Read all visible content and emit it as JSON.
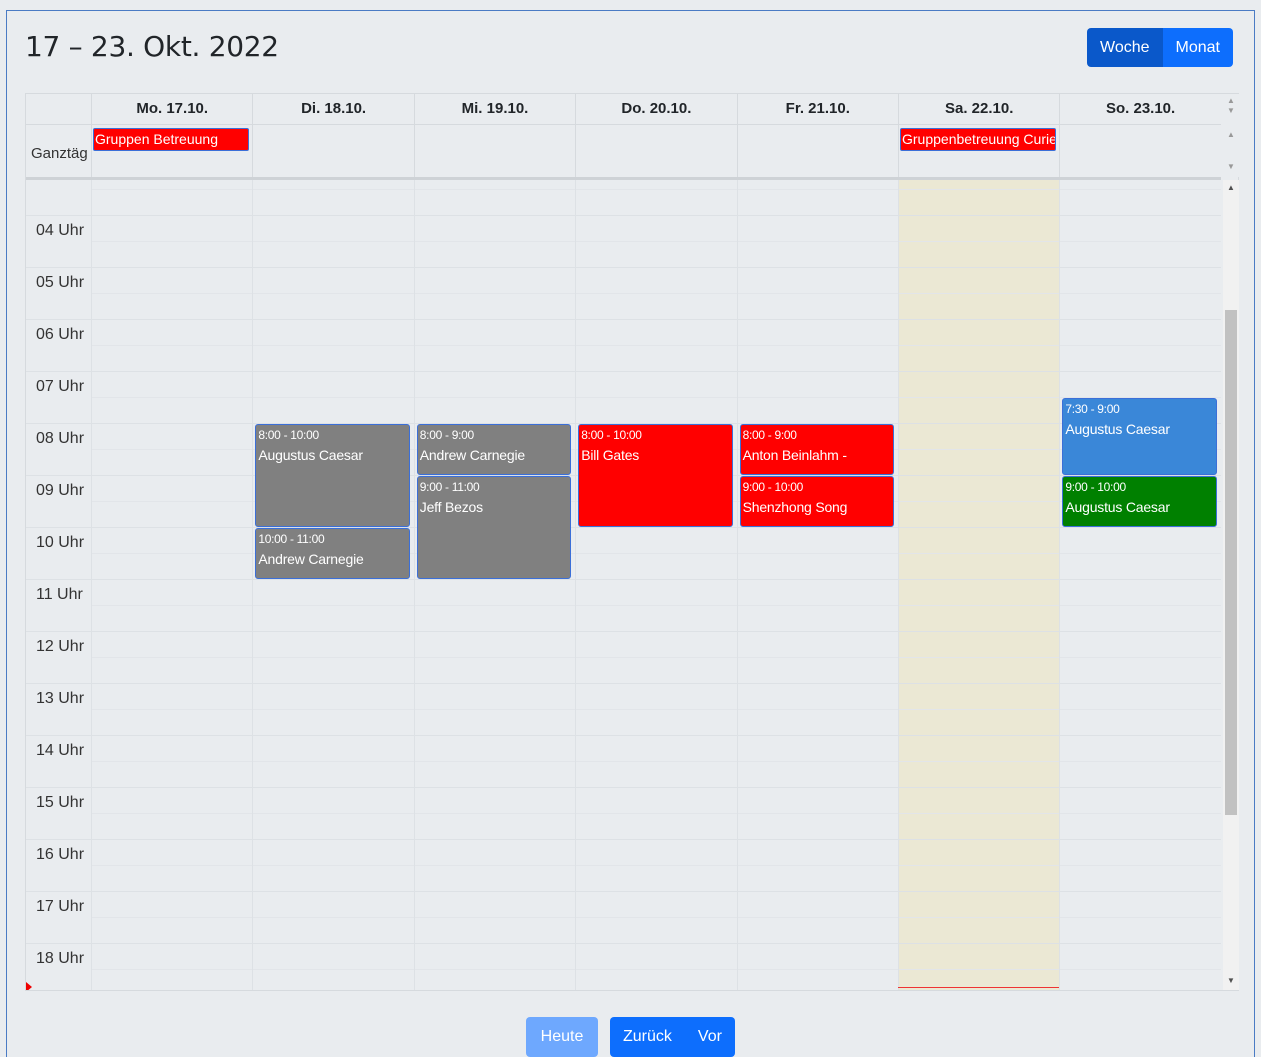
{
  "header": {
    "title": "17 – 23. Okt. 2022",
    "view_week": "Woche",
    "view_month": "Monat"
  },
  "allday_label": "Ganztäg",
  "days": [
    {
      "label": "Mo. 17.10."
    },
    {
      "label": "Di. 18.10."
    },
    {
      "label": "Mi. 19.10."
    },
    {
      "label": "Do. 20.10."
    },
    {
      "label": "Fr. 21.10."
    },
    {
      "label": "Sa. 22.10."
    },
    {
      "label": "So. 23.10."
    }
  ],
  "hours": [
    "04 Uhr",
    "05 Uhr",
    "06 Uhr",
    "07 Uhr",
    "08 Uhr",
    "09 Uhr",
    "10 Uhr",
    "11 Uhr",
    "12 Uhr",
    "13 Uhr",
    "14 Uhr",
    "15 Uhr",
    "16 Uhr",
    "17 Uhr",
    "18 Uhr"
  ],
  "allday_events": [
    {
      "day": 0,
      "title": "Gruppen Betreuung"
    },
    {
      "day": 5,
      "title": "Gruppenbetreuung Curie"
    }
  ],
  "events": [
    {
      "day": 1,
      "start": 8,
      "end": 10,
      "time": "8:00 - 10:00",
      "title": "Augustus Caesar",
      "color": "gray"
    },
    {
      "day": 1,
      "start": 10,
      "end": 11,
      "time": "10:00 - 11:00",
      "title": "Andrew Carnegie",
      "color": "gray"
    },
    {
      "day": 2,
      "start": 8,
      "end": 9,
      "time": "8:00 - 9:00",
      "title": "Andrew Carnegie",
      "color": "gray"
    },
    {
      "day": 2,
      "start": 9,
      "end": 11,
      "time": "9:00 - 11:00",
      "title": "Jeff Bezos",
      "color": "gray"
    },
    {
      "day": 3,
      "start": 8,
      "end": 10,
      "time": "8:00 - 10:00",
      "title": "Bill Gates",
      "color": "red"
    },
    {
      "day": 4,
      "start": 8,
      "end": 9,
      "time": "8:00 - 9:00",
      "title": "Anton Beinlahm -",
      "color": "red"
    },
    {
      "day": 4,
      "start": 9,
      "end": 10,
      "time": "9:00 - 10:00",
      "title": "Shenzhong Song",
      "color": "red"
    },
    {
      "day": 6,
      "start": 7.5,
      "end": 9,
      "time": "7:30 - 9:00",
      "title": "Augustus Caesar",
      "color": "blue"
    },
    {
      "day": 6,
      "start": 9,
      "end": 10,
      "time": "9:00 - 10:00",
      "title": "Augustus Caesar",
      "color": "green"
    }
  ],
  "today_day": 5,
  "footer": {
    "today": "Heute",
    "back": "Zurück",
    "forward": "Vor"
  },
  "colors": {
    "gray": "#808080",
    "red": "#ff0000",
    "blue": "#3a87d8",
    "green": "#008000",
    "today_bg": "#ebe8d4"
  }
}
